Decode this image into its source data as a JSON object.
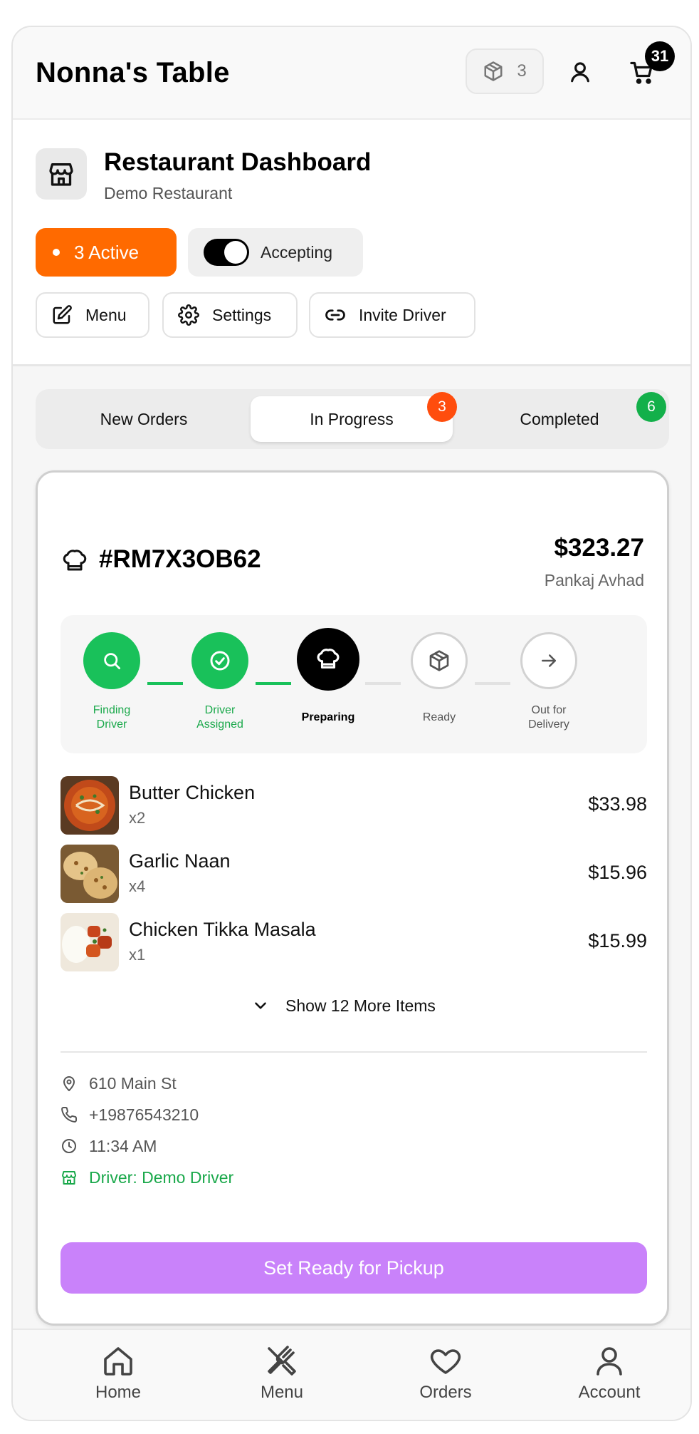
{
  "header": {
    "brand": "Nonna's Table",
    "package_count": "3",
    "cart_count": "31"
  },
  "dashboard": {
    "title": "Restaurant Dashboard",
    "subtitle": "Demo Restaurant",
    "active_label": "3 Active",
    "accepting_label": "Accepting",
    "accepting_on": true,
    "actions": {
      "menu": "Menu",
      "settings": "Settings",
      "invite": "Invite Driver"
    }
  },
  "tabs": {
    "new_orders": "New Orders",
    "in_progress": "In Progress",
    "in_progress_count": "3",
    "completed": "Completed",
    "completed_count": "6",
    "selected": "In Progress"
  },
  "order": {
    "id": "#RM7X3OB62",
    "total": "$323.27",
    "customer": "Pankaj Avhad",
    "steps": [
      {
        "label_line1": "Finding",
        "label_line2": "Driver",
        "state": "done",
        "icon": "search-icon"
      },
      {
        "label_line1": "Driver",
        "label_line2": "Assigned",
        "state": "done",
        "icon": "check-circle-icon"
      },
      {
        "label_line1": "Preparing",
        "label_line2": "",
        "state": "current",
        "icon": "chef-hat-icon"
      },
      {
        "label_line1": "Ready",
        "label_line2": "",
        "state": "todo",
        "icon": "package-icon"
      },
      {
        "label_line1": "Out for",
        "label_line2": "Delivery",
        "state": "todo",
        "icon": "arrow-right-icon"
      }
    ],
    "items": [
      {
        "name": "Butter Chicken",
        "qty": "x2",
        "price": "$33.98"
      },
      {
        "name": "Garlic Naan",
        "qty": "x4",
        "price": "$15.96"
      },
      {
        "name": "Chicken Tikka Masala",
        "qty": "x1",
        "price": "$15.99"
      }
    ],
    "show_more": "Show 12 More Items",
    "address": "610 Main St",
    "phone": "+19876543210",
    "time": "11:34 AM",
    "driver": "Driver: Demo Driver",
    "cta": "Set Ready for Pickup"
  },
  "bottom_nav": {
    "home": "Home",
    "menu": "Menu",
    "orders": "Orders",
    "account": "Account"
  },
  "colors": {
    "accent_orange": "#ff6a00",
    "success_green": "#19c15a",
    "cta_purple": "#c982fa",
    "badge_red": "#ff4d0d",
    "badge_green": "#13b04a"
  }
}
